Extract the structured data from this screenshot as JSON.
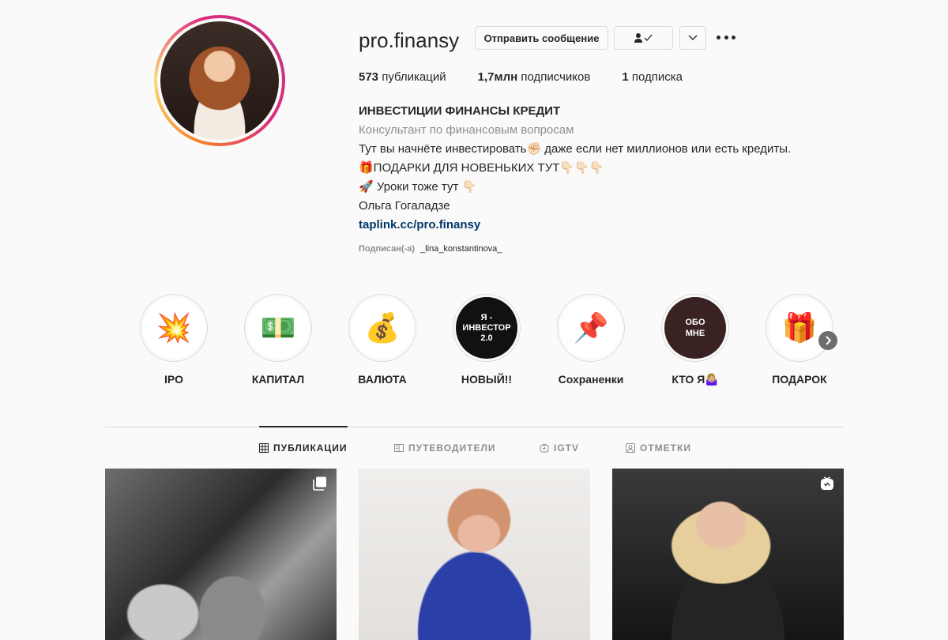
{
  "profile": {
    "username": "pro.finansy",
    "message_button": "Отправить сообщение",
    "follow_button_icon": "👤✓",
    "dropdown_icon": "⌄",
    "stats": {
      "posts_count": "573",
      "posts_label": "публикаций",
      "followers_count": "1,7млн",
      "followers_label": "подписчиков",
      "following_count": "1",
      "following_label": "подписка"
    },
    "bio": {
      "title": "ИНВЕСТИЦИИ ФИНАНСЫ КРЕДИТ",
      "category": "Консультант по финансовым вопросам",
      "line1": "Тут вы начнёте инвестировать✊🏻 даже если нет миллионов или есть кредиты.",
      "line2": "🎁ПОДАРКИ ДЛЯ НОВЕНЬКИХ ТУТ👇🏻👇🏻👇🏻",
      "line3": "🚀 Уроки тоже тут 👇🏻",
      "line4": "Ольга Гогаладзе",
      "link": "taplink.cc/pro.finansy"
    },
    "followed_by_label": "Подписан(-а)",
    "followed_by_user": "_lina_konstantinova_"
  },
  "highlights": [
    {
      "label": "IPO",
      "icon": "💥"
    },
    {
      "label": "КАПИТАЛ",
      "icon": "💵"
    },
    {
      "label": "ВАЛЮТА",
      "icon": "💰"
    },
    {
      "label": "НОВЫЙ!!",
      "icon": "Я - ИНВЕСТОР 2.0"
    },
    {
      "label": "Сохраненки",
      "icon": "📌"
    },
    {
      "label": "КТО Я🤷🏼‍♀️",
      "icon": "ОБО МНЕ"
    },
    {
      "label": "ПОДАРОК",
      "icon": "🎁"
    }
  ],
  "tabs": [
    {
      "label": "ПУБЛИКАЦИИ",
      "icon": "grid-icon",
      "active": true
    },
    {
      "label": "ПУТЕВОДИТЕЛИ",
      "icon": "guides-icon",
      "active": false
    },
    {
      "label": "IGTV",
      "icon": "igtv-icon",
      "active": false
    },
    {
      "label": "ОТМЕТКИ",
      "icon": "tagged-icon",
      "active": false
    }
  ],
  "posts": [
    {
      "badge": "carousel-icon"
    },
    {
      "badge": ""
    },
    {
      "badge": "reels-icon"
    }
  ]
}
